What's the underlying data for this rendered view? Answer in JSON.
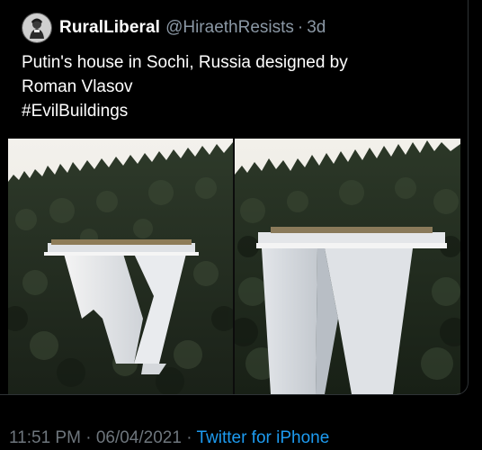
{
  "tweet": {
    "display_name": "RuralLiberal",
    "handle": "@HiraethResists",
    "separator": "·",
    "time_ago": "3d",
    "text_lines": [
      "Putin's house in Sochi, Russia designed by",
      "Roman Vlasov",
      "#EvilBuildings"
    ],
    "avatar_icon": "user-avatar-icon",
    "media": [
      {
        "name": "photo-left",
        "description_icon": "house-photo-left"
      },
      {
        "name": "photo-right",
        "description_icon": "house-photo-right"
      }
    ]
  },
  "footer": {
    "time": "11:51 PM",
    "separator1": "·",
    "date": "06/04/2021",
    "separator2": "·",
    "source": "Twitter for iPhone"
  },
  "colors": {
    "background": "#000000",
    "primary_text": "#ffffff",
    "secondary_text": "#8b98a5",
    "link": "#1d9bf0"
  }
}
